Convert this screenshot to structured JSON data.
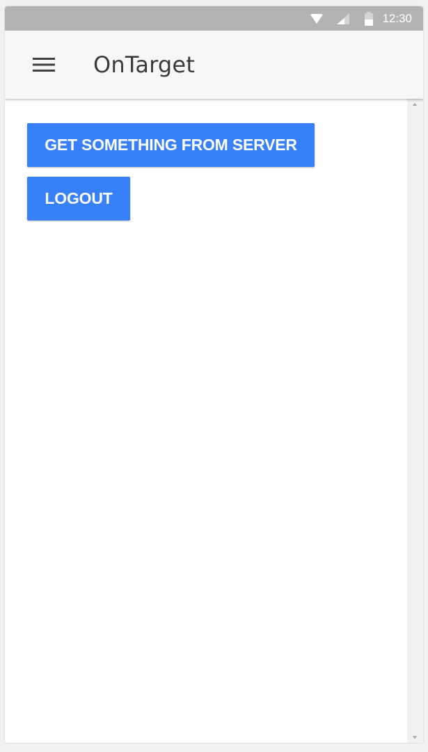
{
  "status_bar": {
    "time": "12:30",
    "icons": [
      "wifi-icon",
      "cell-signal-icon",
      "battery-icon"
    ]
  },
  "app_bar": {
    "title": "OnTarget",
    "menu_icon": "hamburger-menu-icon"
  },
  "main": {
    "buttons": [
      {
        "label": "GET SOMETHING FROM SERVER"
      },
      {
        "label": "LOGOUT"
      }
    ]
  },
  "colors": {
    "status_bar": "#b2b3b5",
    "app_bar": "#f7f7f7",
    "button": "#3880f7",
    "title_text": "#3a3a3a"
  }
}
